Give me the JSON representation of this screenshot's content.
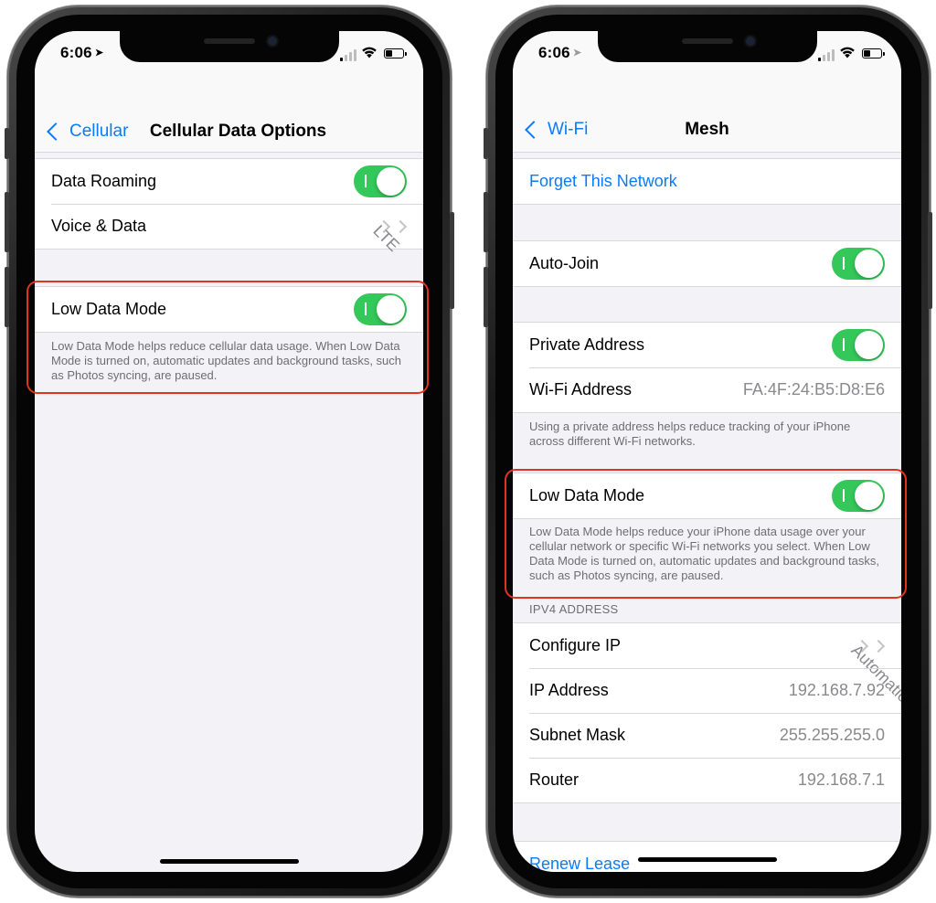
{
  "left": {
    "status": {
      "time": "6:06"
    },
    "nav": {
      "back": "Cellular",
      "title": "Cellular Data Options"
    },
    "rows": {
      "data_roaming": "Data Roaming",
      "voice_data": "Voice & Data",
      "voice_data_value": "LTE",
      "low_data_mode": "Low Data Mode"
    },
    "footer": "Low Data Mode helps reduce cellular data usage. When Low Data Mode is turned on, automatic updates and background tasks, such as Photos syncing, are paused."
  },
  "right": {
    "status": {
      "time": "6:06"
    },
    "nav": {
      "back": "Wi-Fi",
      "title": "Mesh"
    },
    "rows": {
      "forget": "Forget This Network",
      "auto_join": "Auto-Join",
      "private_address": "Private Address",
      "wifi_address": "Wi-Fi Address",
      "wifi_address_value": "FA:4F:24:B5:D8:E6",
      "low_data_mode": "Low Data Mode",
      "configure_ip": "Configure IP",
      "configure_ip_value": "Automatic",
      "ip_address": "IP Address",
      "ip_address_value": "192.168.7.92",
      "subnet_mask": "Subnet Mask",
      "subnet_mask_value": "255.255.255.0",
      "router": "Router",
      "router_value": "192.168.7.1",
      "renew_lease": "Renew Lease"
    },
    "private_footer": "Using a private address helps reduce tracking of your iPhone across different Wi-Fi networks.",
    "low_data_footer": "Low Data Mode helps reduce your iPhone data usage over your cellular network or specific Wi-Fi networks you select. When Low Data Mode is turned on, automatic updates and background tasks, such as Photos syncing, are paused.",
    "ipv4_header": "IPV4 ADDRESS"
  },
  "colors": {
    "accent": "#0a7aff",
    "toggle_on": "#34c759",
    "highlight": "#e0341e"
  }
}
